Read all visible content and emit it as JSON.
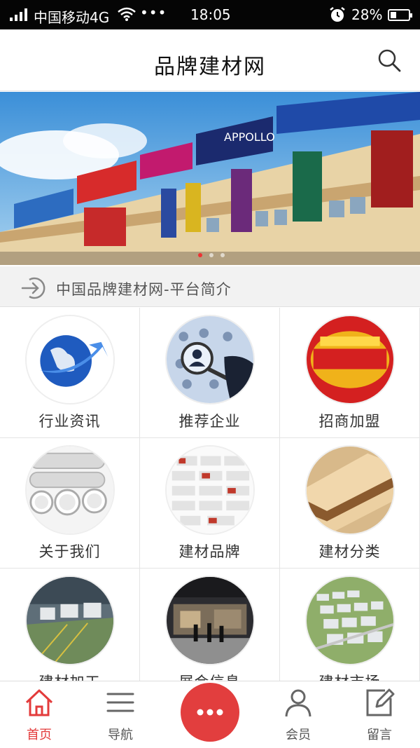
{
  "status_bar": {
    "carrier": "中国移动4G",
    "dots": "•••",
    "time": "18:05",
    "battery": "28%"
  },
  "header": {
    "title": "品牌建材网",
    "search_icon": "search-icon"
  },
  "banner": {
    "image": "building-materials-market-photo",
    "slides": 3,
    "active_slide": 1
  },
  "notice": {
    "icon": "arrow-enter-icon",
    "text": "中国品牌建材网-平台简介"
  },
  "grid": {
    "items": [
      {
        "label": "行业资讯",
        "icon": "globe-arrow-image"
      },
      {
        "label": "推荐企业",
        "icon": "magnifier-people-image"
      },
      {
        "label": "招商加盟",
        "icon": "recruit-banner-image"
      },
      {
        "label": "关于我们",
        "icon": "pipes-image"
      },
      {
        "label": "建材品牌",
        "icon": "brand-logos-image"
      },
      {
        "label": "建材分类",
        "icon": "wood-boards-image"
      },
      {
        "label": "建材加工",
        "icon": "factory-image"
      },
      {
        "label": "展会信息",
        "icon": "exhibition-image"
      },
      {
        "label": "建材市场",
        "icon": "market-aerial-image"
      }
    ]
  },
  "bottom_nav": {
    "items": [
      {
        "label": "首页",
        "icon": "home-icon",
        "active": true
      },
      {
        "label": "导航",
        "icon": "menu-icon",
        "active": false
      },
      {
        "label": "",
        "icon": "more-dots-icon",
        "active": false
      },
      {
        "label": "会员",
        "icon": "user-icon",
        "active": false
      },
      {
        "label": "留言",
        "icon": "edit-icon",
        "active": false
      }
    ]
  },
  "colors": {
    "accent": "#e23e3e",
    "status_bar": "#050505",
    "notice_bg": "#f2f2f2"
  }
}
